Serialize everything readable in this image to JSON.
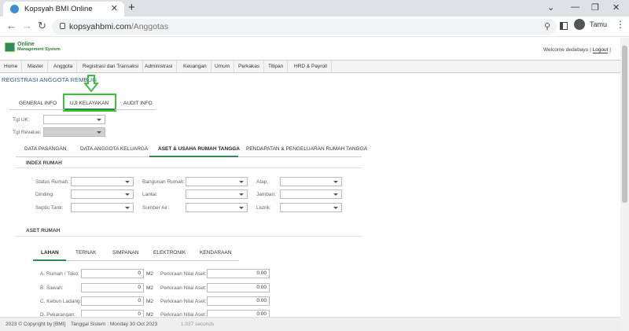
{
  "browser": {
    "tab_title": "Kopsyah BMI Online",
    "url_host": "kopsyahbmi.com",
    "url_path": "/Anggotas",
    "profile_name": "Tamu"
  },
  "header": {
    "logo_line1": "Online",
    "logo_line2": "Management System",
    "welcome_text": "Welcome dedebayu | ",
    "logout": "Logout",
    "close_bracket": "|"
  },
  "menu": [
    "Home",
    "Master",
    "Anggota",
    "Registrasi dan Transaksi",
    "Administrasi",
    "Keuangan",
    "Umum",
    "Perkakas",
    "Titipan",
    "HRD & Payroll"
  ],
  "page_title": "REGISTRASI ANGGOTA REMBUG",
  "top_tabs": [
    "GENERAL INFO",
    "UJI KELAYAKAN",
    "AUDIT INFO"
  ],
  "tgl_uk_label": "Tgl UK:",
  "tgl_revalue_label": "Tgl Revalue:",
  "sub_tabs": [
    "DATA PASANGAN",
    "DATA ANGGOTA KELUARGA",
    "ASET & USAHA RUMAH TANGGA",
    "PENDAPATAN & PENGELUARAN RUMAH TANGGA"
  ],
  "index_rumah": {
    "title": "INDEX RUMAH",
    "col1": [
      "Status Rumah:",
      "Dinding:",
      "Septic Tank:"
    ],
    "col2": [
      "Bangunan Rumah:",
      "Lantai:",
      "Sumber Air:"
    ],
    "col3": [
      "Atap:",
      "Jamban:",
      "Listrik:"
    ]
  },
  "aset_rumah": {
    "title": "ASET RUMAH",
    "tabs": [
      "LAHAN",
      "TERNAK",
      "SIMPANAN",
      "ELEKTRONIK",
      "KENDARAAN"
    ],
    "rows": [
      {
        "label": "A. Rumah / Toko:",
        "value": "0",
        "unit": "M2",
        "est_label": "Perkiraan Nilai Aset:",
        "est_value": "0.00"
      },
      {
        "label": "B. Sawah:",
        "value": "0",
        "unit": "M2",
        "est_label": "Perkiraan Nilai Aset:",
        "est_value": "0.00"
      },
      {
        "label": "C. Kebun Ladang:",
        "value": "0",
        "unit": "M2",
        "est_label": "Perkiraan Nilai Aset:",
        "est_value": "0.00"
      },
      {
        "label": "D. Pekarangan:",
        "value": "0",
        "unit": "M2",
        "est_label": "Perkiraan Nilai Aset:",
        "est_value": "0.00"
      }
    ]
  },
  "footer": {
    "copyright": "2023 © Copyright by [BMI]",
    "system_date": "Tanggal Sistem : Monday 30 Oct 2023",
    "timing": "1.937 seconds"
  },
  "colors": {
    "accent_green": "#2e8b57",
    "highlight_green": "#3fbf3f",
    "title_blue": "#2f5b8a"
  }
}
